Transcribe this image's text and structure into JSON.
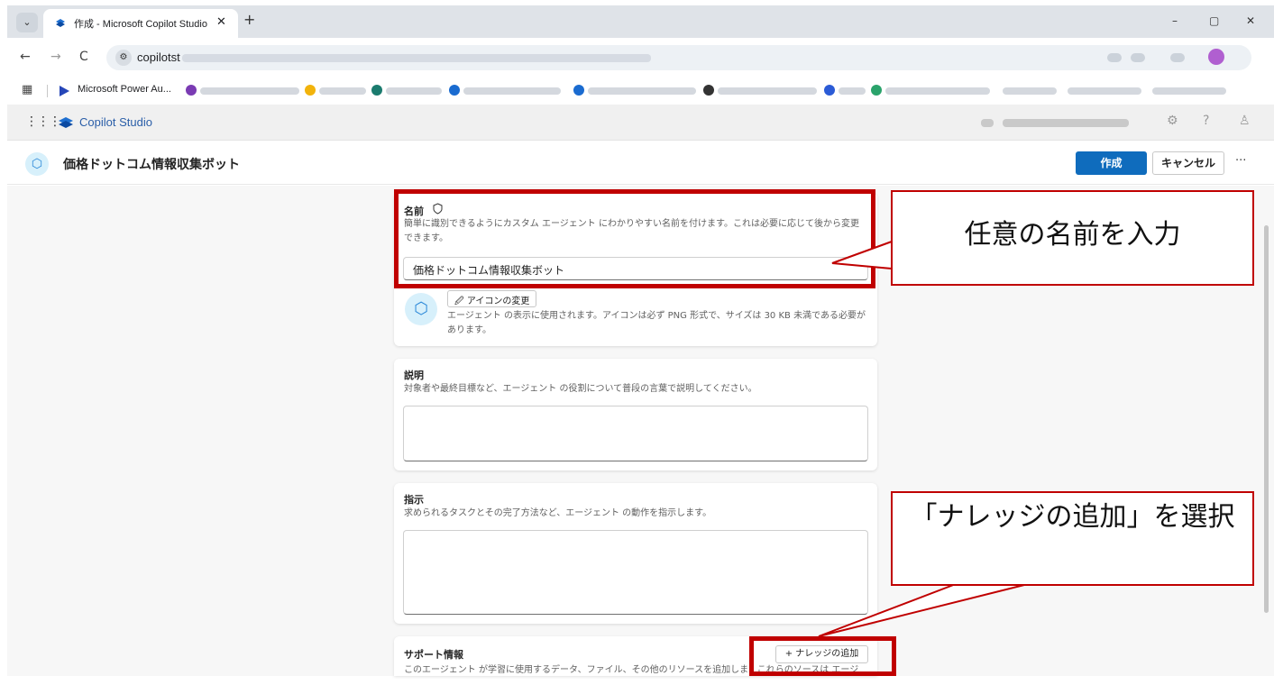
{
  "browser": {
    "tab_title": "作成 - Microsoft Copilot Studio",
    "tab_close": "✕",
    "new_tab": "+",
    "url_visible": "copilotst",
    "window_controls": [
      "–",
      "▢",
      "✕"
    ],
    "nav": [
      "←",
      "→",
      "C"
    ]
  },
  "bookmarks": {
    "apps_icon": "grid-icon",
    "first_label": "Microsoft Power Au..."
  },
  "app": {
    "waffle": "⋮⋮⋮",
    "name": "Copilot Studio"
  },
  "agent": {
    "title": "価格ドットコム情報収集ボット",
    "create_label": "作成",
    "cancel_label": "キャンセル",
    "more_label": "···"
  },
  "name_card": {
    "label": "名前",
    "help": "簡単に識別できるようにカスタム エージェント にわかりやすい名前を付けます。これは必要に応じて後から変更できます。",
    "value": "価格ドットコム情報収集ボット",
    "change_icon_label": "アイコンの変更",
    "icon_help": "エージェント の表示に使用されます。アイコンは必ず PNG 形式で、サイズは 30 KB 未満である必要があります。"
  },
  "description_card": {
    "label": "説明",
    "help": "対象者や最終目標など、エージェント の役割について普段の言葉で説明してください。",
    "value": ""
  },
  "instructions_card": {
    "label": "指示",
    "help": "求められるタスクとその完了方法など、エージェント の動作を指示します。",
    "value": ""
  },
  "knowledge_card": {
    "label": "サポート情報",
    "add_label": "+ ナレッジの追加",
    "help": "このエージェント が学習に使用するデータ、ファイル、その他のリソースを追加しま..  これらのソースは エージ"
  },
  "annotations": {
    "callout_name": "任意の名前を入力",
    "callout_knowledge": "「ナレッジの追加」を選択",
    "color": "#c00000"
  },
  "colors": {
    "primary": "#0f6cbd",
    "brand_blue": "#2a5ea8",
    "accent_red": "#c00000"
  }
}
